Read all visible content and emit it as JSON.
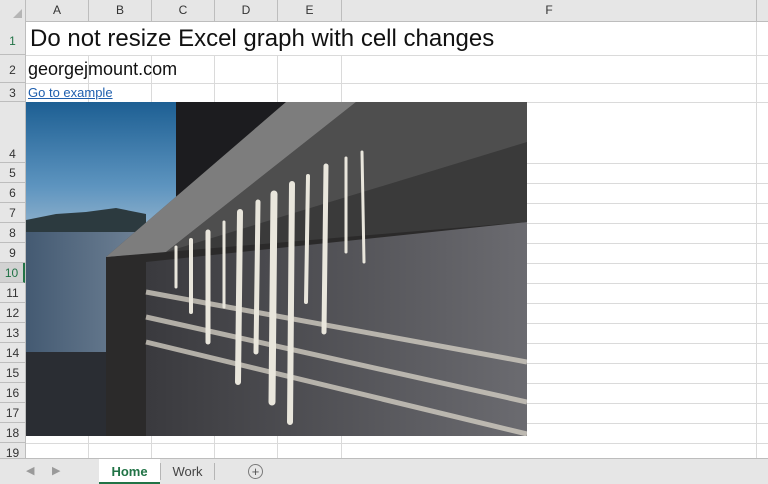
{
  "columns": [
    "A",
    "B",
    "C",
    "D",
    "E",
    "F"
  ],
  "rows": [
    "1",
    "2",
    "3",
    "4",
    "5",
    "6",
    "7",
    "8",
    "9",
    "10",
    "11",
    "12",
    "13",
    "14",
    "15",
    "16",
    "17",
    "18",
    "19"
  ],
  "cells": {
    "A1": "Do not resize Excel graph with cell changes",
    "A2": "georgejmount.com",
    "A3": "Go to example"
  },
  "sheet_tabs": [
    {
      "label": "Home",
      "active": true
    },
    {
      "label": "Work",
      "active": false
    }
  ],
  "icons": {
    "prev_sheet": "triangle-left-icon",
    "next_sheet": "triangle-right-icon",
    "add_sheet": "plus-circle-icon",
    "select_all": "select-all-triangle-icon"
  },
  "colors": {
    "accent": "#217346",
    "link": "#1f5fae",
    "header_bg": "#e6e6e6",
    "grid": "#dadada"
  }
}
